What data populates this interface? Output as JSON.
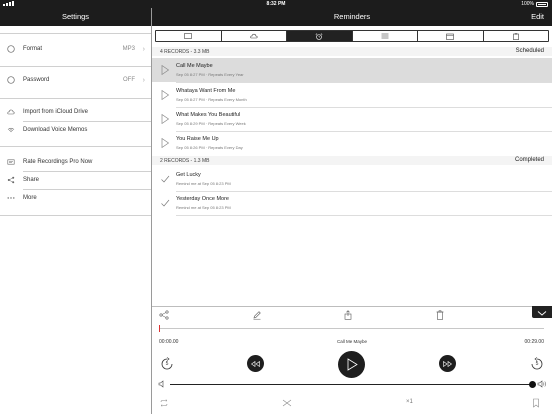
{
  "status": {
    "time": "8:32 PM",
    "battery": "100%"
  },
  "left_nav": {
    "title": "Settings"
  },
  "right_nav": {
    "title": "Reminders",
    "edit_label": "Edit"
  },
  "settings": {
    "format": {
      "label": "Format",
      "value": "MP3"
    },
    "password": {
      "label": "Password",
      "value": "OFF"
    },
    "icloud": {
      "label": "Import from iCloud Drive"
    },
    "voice_memos": {
      "label": "Download Voice Memos"
    },
    "rate": {
      "label": "Rate Recordings Pro Now"
    },
    "share": {
      "label": "Share"
    },
    "more": {
      "label": "More"
    }
  },
  "tabs": [
    {
      "icon": "screen-icon"
    },
    {
      "icon": "cloud-icon"
    },
    {
      "icon": "alarm-clock-icon"
    },
    {
      "icon": "list-icon"
    },
    {
      "icon": "calendar-icon"
    },
    {
      "icon": "clipboard-icon"
    }
  ],
  "scheduled": {
    "count": "4 RECORDS - 3.3 MB",
    "label": "Scheduled",
    "items": [
      {
        "title": "Call Me Maybe",
        "sub": "Sep 05 8:27 PM  ·  Repeats Every Year"
      },
      {
        "title": "Whataya Want From Me",
        "sub": "Sep 05 8:27 PM  ·  Repeats Every Month"
      },
      {
        "title": "What Makes You Beautiful",
        "sub": "Sep 05 8:29 PM  ·  Repeats Every Week"
      },
      {
        "title": "You Raise Me Up",
        "sub": "Sep 05 8:26 PM  ·  Repeats Every Day"
      }
    ]
  },
  "completed": {
    "count": "2 RECORDS - 1.3 MB",
    "label": "Completed",
    "items": [
      {
        "title": "Get Lucky",
        "sub": "Remind me at Sep 05 8:23 PM"
      },
      {
        "title": "Yesterday Once More",
        "sub": "Remind me at Sep 05 8:23 PM"
      }
    ]
  },
  "player": {
    "elapsed": "00:00.00",
    "track": "Call Me Maybe",
    "duration": "00:29.00",
    "skip_back_seconds": "5",
    "skip_forward_seconds": "5",
    "speed": "×1",
    "progress_fraction": 0,
    "volume_fraction": 1
  }
}
